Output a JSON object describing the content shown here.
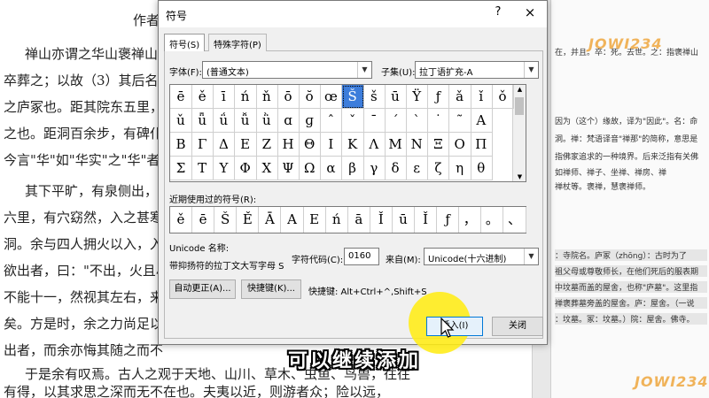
{
  "document": {
    "left_lines": [
      "作者",
      "禅山亦谓之华山褒禅山",
      "卒葬之；以故（3）其后名",
      "之庐冢也。距其院东五里，",
      "之也。距洞百余步，有碑仆",
      "今言\"华\"如\"华实\"之\"华\"者，",
      "其下平旷，有泉侧出，",
      "六里，有穴窈然，入之甚寒",
      "洞。余与四人拥火以入，入",
      "欲出者，曰：\"不出，火且尽",
      "不能十一，然视其左右，来",
      "矣。方是时，余之力尚足以",
      "出者，而余亦悔其随之而不",
      "于是余有叹焉。古人之观于天地、山川、草木、虫鱼、鸟兽，往往",
      "有得，以其求思之深而无不在也。夫夷以近，则游者众；险以远，"
    ],
    "right_notes": [
      "",
      "在，并且。卒：死。去世。之：指褒禅山",
      "",
      "",
      "因为（这个）缘故，译为\"因此\"。名：命",
      "洞。禅：梵语译音\"禅那\"的简称，意思是",
      "指佛家追求的一种境界。后来泛指有关佛",
      "如禅师、禅子、坐禅、禅房、禅",
      "禅杖等。褒禅，慧褒禅师。",
      "",
      "",
      "",
      "",
      "：寺院名。庐冢（zhōng）：古时为了",
      "祖父母或尊敬师长，在他们死后的服表期",
      "中坟墓而盖的屋舍，也称\"庐墓\"。这里指",
      "禅褒葬墓旁盖的屋舍。庐：屋舍。（一说",
      "：坟墓。冢：坟墓。）院：屋舍。佛寺。"
    ],
    "watermark": "JOWI234"
  },
  "dialog": {
    "title": "符号",
    "help": "?",
    "close": "×",
    "tabs": [
      "符号(S)",
      "特殊字符(P)"
    ],
    "font_label": "字体(F):",
    "font_value": "(普通文本)",
    "subset_label": "子集(U):",
    "subset_value": "拉丁语扩充-A",
    "grid_rows": [
      [
        "ē",
        "ě",
        "ī",
        "ń",
        "ň",
        "ō",
        "ŏ",
        "œ",
        "Š",
        "š",
        "ū",
        "Ÿ",
        "ƒ",
        "ǎ",
        "ǐ",
        "ǒ"
      ],
      [
        "ǔ",
        "ǖ",
        "ǘ",
        "ǚ",
        "ǜ",
        "ɑ",
        "ɡ",
        "ˆ",
        "ˇ",
        "ˉ",
        "ˊ",
        "ˋ",
        "˙",
        "˜",
        "А",
        ""
      ],
      [
        "Β",
        "Γ",
        "Δ",
        "Ε",
        "Ζ",
        "Η",
        "Θ",
        "Ι",
        "Κ",
        "Λ",
        "Μ",
        "Ν",
        "Ξ",
        "Ο",
        "Π",
        ""
      ],
      [
        "Σ",
        "Τ",
        "Υ",
        "Φ",
        "Χ",
        "Ψ",
        "Ω",
        "α",
        "β",
        "γ",
        "δ",
        "ε",
        "ζ",
        "η",
        "θ",
        ""
      ]
    ],
    "selected_symbol": "Š",
    "recent_label": "近期使用过的符号(R):",
    "recent_symbols": [
      "ě",
      "ē",
      "Š",
      "Ě",
      "Ā",
      "A",
      "E",
      "ń",
      "ā",
      "Ǐ",
      "ū",
      "Ǐ",
      "ƒ",
      "，",
      "。",
      "、"
    ],
    "unicode_name_label": "Unicode 名称:",
    "unicode_name_value": "带抑扬符的拉丁文大写字母 S",
    "char_code_label": "字符代码(C):",
    "char_code_value": "0160",
    "from_label": "来自(M):",
    "from_value": "Unicode(十六进制)",
    "autocorrect_button": "自动更正(A)...",
    "shortcut_button": "快捷键(K)...",
    "shortcut_text": "快捷键: Alt+Ctrl+^,Shift+S",
    "insert_button": "插入(I)",
    "cancel_button": "关闭"
  },
  "caption": "可以继续添加",
  "colors": {
    "selection": "#3d7ddb",
    "highlight": "#ffec14",
    "watermark": "#f0b35a"
  }
}
